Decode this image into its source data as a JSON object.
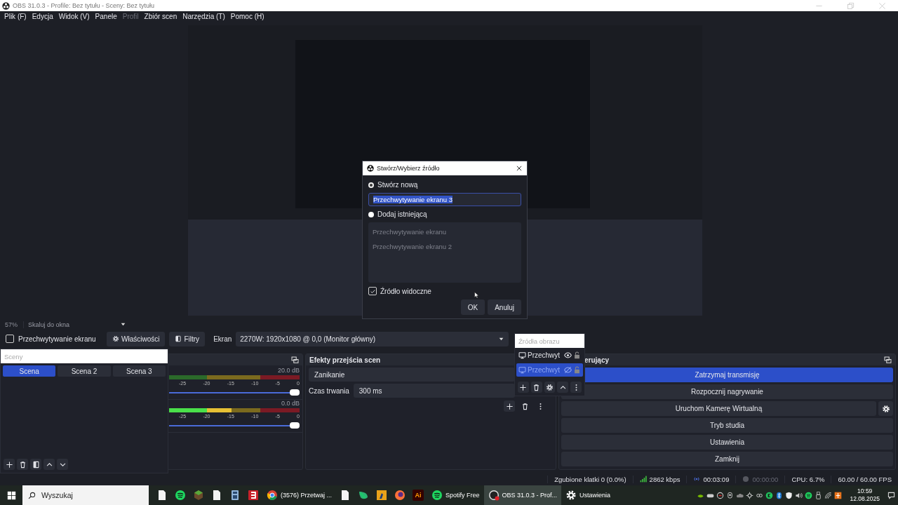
{
  "window": {
    "title": "OBS 31.0.3 - Profile: Bez tytułu - Sceny: Bez tytułu"
  },
  "menu": [
    {
      "label": "Plik (F)",
      "disabled": false
    },
    {
      "label": "Edycja",
      "disabled": false
    },
    {
      "label": "Widok (V)",
      "disabled": false
    },
    {
      "label": "Panele",
      "disabled": false
    },
    {
      "label": "Profil",
      "disabled": true
    },
    {
      "label": "Zbiór scen",
      "disabled": false
    },
    {
      "label": "Narzędzia (T)",
      "disabled": false
    },
    {
      "label": "Pomoc (H)",
      "disabled": false
    }
  ],
  "zoom": {
    "percent": "57%",
    "mode": "Skaluj do okna"
  },
  "source_toolbar": {
    "source": {
      "label": "Przechwytywanie ekranu",
      "checked": false
    },
    "buttons": [
      {
        "label": "Właściwości",
        "kind": "properties"
      },
      {
        "label": "Filtry",
        "kind": "filters"
      }
    ],
    "display_label": "Ekran",
    "display_value": "2270W: 1920x1080 @ 0,0 (Monitor główny)"
  },
  "mixer": {
    "channels": [
      {
        "reading": "20.0 dB",
        "meter": {
          "level": 0
        },
        "ticks": [
          "-25",
          "-20",
          "-15",
          "-10",
          "-5",
          "0"
        ],
        "fader": {
          "level": 1
        }
      },
      {
        "reading": "0.0 dB",
        "meter": {
          "level": 0.48
        },
        "ticks": [
          "-25",
          "-20",
          "-15",
          "-10",
          "-5",
          "0"
        ],
        "fader": {
          "level": 1
        }
      }
    ]
  },
  "transitions": {
    "title": "Efekty przejścia scen",
    "transition": "Zanikanie",
    "duration_label": "Czas trwania",
    "duration": "300 ms"
  },
  "controls": {
    "title": "erujący",
    "buttons": [
      {
        "label": "Zatrzymaj transmisję",
        "active": true,
        "settings": false
      },
      {
        "label": "Rozpocznij nagrywanie",
        "active": false,
        "settings": false
      },
      {
        "label": "Uruchom Kamerę Wirtualną",
        "active": false,
        "settings": true
      },
      {
        "label": "Tryb studia",
        "active": false,
        "settings": false
      },
      {
        "label": "Ustawienia",
        "active": false,
        "settings": false
      },
      {
        "label": "Zamknij",
        "active": false,
        "settings": false
      }
    ]
  },
  "status_bar": {
    "dropped": "Zgubione klatki 0 (0.0%)",
    "bitrate": "2862 kbps",
    "stream_time": "00:03:09",
    "recording": false,
    "record_time": "00:00:00",
    "cpu": "CPU: 6.7%",
    "fps": "60.00 / 60.00 FPS"
  },
  "scenes_popup": {
    "placeholder": "Sceny",
    "scenes": [
      {
        "label": "Scena",
        "selected": true
      },
      {
        "label": "Scena 2",
        "selected": false
      },
      {
        "label": "Scena 3",
        "selected": false
      }
    ]
  },
  "sources_popup": {
    "placeholder": "Źródła obrazu",
    "sources": [
      {
        "label": "Przechwyt",
        "visible": true,
        "locked": false,
        "selected": false
      },
      {
        "label": "Przechwyt",
        "visible": false,
        "locked": false,
        "selected": true
      }
    ]
  },
  "dialog": {
    "title": "Stwórz/Wybierz źródło",
    "options": [
      {
        "label": "Stwórz nową",
        "selected": true
      },
      {
        "label": "Dodaj istniejącą",
        "selected": false
      }
    ],
    "name_value": "Przechwytywanie ekranu 3",
    "existing": {
      "disabled": true,
      "items": [
        "Przechwytywanie ekranu",
        "Przechwytywanie ekranu 2"
      ]
    },
    "visible_checkbox": {
      "label": "Źródło widoczne",
      "checked": true
    },
    "buttons": [
      "OK",
      "Anuluj"
    ]
  },
  "taskbar": {
    "search_placeholder": "Wyszukaj",
    "apps": [
      {
        "selected": false
      },
      {
        "selected": false
      },
      {
        "selected": false
      },
      {
        "selected": false
      },
      {
        "selected": false
      },
      {
        "selected": false
      },
      {
        "label": "(3576) Przetwaj ...",
        "selected": false
      },
      {
        "selected": false
      },
      {
        "selected": false
      },
      {
        "selected": false
      },
      {
        "selected": false
      },
      {
        "badge": "Ai",
        "selected": false
      },
      {
        "label": "Spotify Free",
        "selected": false
      },
      {
        "label": "OBS 31.0.3 - Prof...",
        "selected": true
      },
      {
        "label": "Ustawienia",
        "selected": false
      }
    ],
    "time": "10:59",
    "date": "12.08.2025"
  }
}
